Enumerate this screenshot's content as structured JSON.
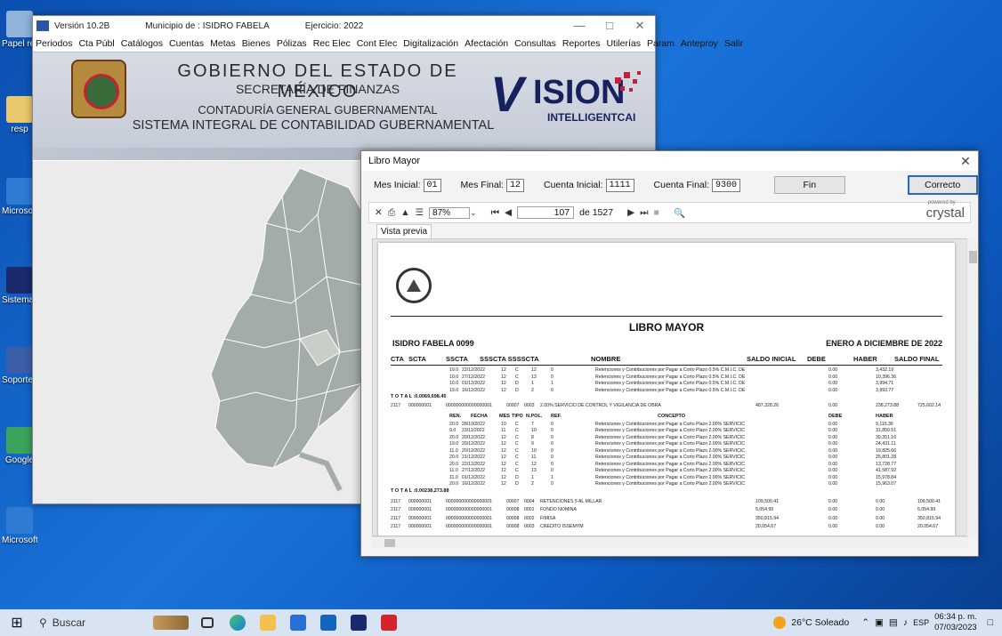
{
  "desktop": {
    "icons": [
      {
        "label": "Papel recicl",
        "icon": "recycle-bin-icon"
      },
      {
        "label": "resp",
        "icon": "folder-icon"
      },
      {
        "label": "Microsoft",
        "icon": "edge-icon"
      },
      {
        "label": "Sistema Conta",
        "icon": "vision-icon"
      },
      {
        "label": "Soporte C",
        "icon": "support-icon"
      },
      {
        "label": "Google",
        "icon": "chrome-icon"
      },
      {
        "label": "Microsoft Edge",
        "icon": "edge-icon"
      }
    ]
  },
  "main_window": {
    "version": "Versión 10.2B",
    "municipio": "Municipio de : ISIDRO FABELA",
    "ejercicio": "Ejercicio: 2022",
    "menu": [
      "Periodos",
      "Cta Públ",
      "Catálogos",
      "Cuentas",
      "Metas",
      "Bienes",
      "Pólizas",
      "Rec Elec",
      "Cont Elec",
      "Digitalización",
      "Afectación",
      "Consultas",
      "Reportes",
      "Utilerías",
      "Param",
      "Anteproy",
      "Salir"
    ],
    "banner": {
      "line1": "GOBIERNO DEL ESTADO DE MÉXICO",
      "line2": "SECRETARÍA DE FINANZAS",
      "line3": "CONTADURÍA GENERAL GUBERNAMENTAL",
      "line4": "SISTEMA INTEGRAL DE CONTABILIDAD GUBERNAMENTAL",
      "logo_v": "V",
      "logo_ision": "ISION",
      "logo_tag": "INTELLIGENTCAI"
    }
  },
  "libro_mayor": {
    "title": "Libro Mayor",
    "params": {
      "mes_inicial_label": "Mes Inicial:",
      "mes_inicial": "01",
      "mes_final_label": "Mes Final:",
      "mes_final": "12",
      "cuenta_inicial_label": "Cuenta Inicial:",
      "cuenta_inicial": "1111",
      "cuenta_final_label": "Cuenta Final:",
      "cuenta_final": "9300"
    },
    "fin_button": "Fin",
    "correcto_button": "Correcto",
    "toolbar": {
      "zoom": "87%",
      "page": "107",
      "page_of": "de 1527",
      "crystal_small": "powered by",
      "crystal": "crystal"
    },
    "tab": "Vista previa",
    "report": {
      "title": "LIBRO MAYOR",
      "municipio": "ISIDRO FABELA 0099",
      "periodo": "ENERO A DICIEMBRE DE 2022",
      "headers": [
        "CTA",
        "SCTA",
        "SSCTA",
        "SSSCTA SSSSCTA",
        "NOMBRE",
        "SALDO INICIAL",
        "DEBE",
        "HABER",
        "SALDO FINAL"
      ],
      "top_rows": [
        [
          "19.0",
          "22/12/2022",
          "12",
          "C",
          "12",
          "0",
          "Retenciones y Contribuciones por Pagar a Corto Plazo 0.5% C.M.I.C. DE",
          "0.00",
          "3,432.19"
        ],
        [
          "10.0",
          "27/12/2022",
          "12",
          "C",
          "13",
          "0",
          "Retenciones y Contribuciones por Pagar a Corto Plazo 0.5% C.M.I.C. DE",
          "0.00",
          "10,396.36"
        ],
        [
          "10.0",
          "01/12/2022",
          "12",
          "D",
          "1",
          "1",
          "Retenciones y Contribuciones por Pagar a Corto Plazo 0.5% C.M.I.C. DE",
          "0.00",
          "3,994.71"
        ],
        [
          "19.0",
          "16/12/2022",
          "12",
          "D",
          "2",
          "0",
          "Retenciones y Contribuciones por Pagar a Corto Plazo 0.5% C.M.I.C. DE",
          "0.00",
          "3,993.77"
        ]
      ],
      "total1_label": "T O T A L :",
      "total1_debe": "0.00",
      "total1_haber": "69,698.45",
      "account_row": [
        "2117",
        "000000001",
        "000000000000000001",
        "00007",
        "0003",
        "2.00% SERVICIO DE CONTROL Y VIGILANCIA DE OBRA",
        "487,328.26",
        "0.00",
        "238,273.88",
        "725,602.14"
      ],
      "sub_headers": [
        "REN.",
        "FECHA",
        "MES",
        "TIPO",
        "N.POL.",
        "REF.",
        "CONCEPTO",
        "DEBE",
        "HABER"
      ],
      "detail_rows": [
        [
          "20.0",
          "28/10/2022",
          "10",
          "C",
          "7",
          "0",
          "Retenciones y Contribuciones por Pagar a Corto Plazo 2.00% SERVICIC",
          "0.00",
          "9,115.36"
        ],
        [
          "9.0",
          "23/11/2022",
          "11",
          "C",
          "10",
          "0",
          "Retenciones y Contribuciones por Pagar a Corto Plazo 2.00% SERVICIC",
          "0.00",
          "31,850.51"
        ],
        [
          "20.0",
          "20/12/2022",
          "12",
          "C",
          "8",
          "0",
          "Retenciones y Contribuciones por Pagar a Corto Plazo 2.00% SERVICIC",
          "0.00",
          "39,351.16"
        ],
        [
          "19.0",
          "20/12/2022",
          "12",
          "C",
          "9",
          "0",
          "Retenciones y Contribuciones por Pagar a Corto Plazo 2.00% SERVICIC",
          "0.00",
          "24,431.11"
        ],
        [
          "11.0",
          "20/12/2022",
          "12",
          "C",
          "10",
          "0",
          "Retenciones y Contribuciones por Pagar a Corto Plazo 2.00% SERVICIC",
          "0.00",
          "19,825.66"
        ],
        [
          "20.0",
          "21/12/2022",
          "12",
          "C",
          "11",
          "0",
          "Retenciones y Contribuciones por Pagar a Corto Plazo 2.00% SERVICIC",
          "0.00",
          "25,801.28"
        ],
        [
          "20.0",
          "22/12/2022",
          "12",
          "C",
          "12",
          "0",
          "Retenciones y Contribuciones por Pagar a Corto Plazo 2.00% SERVICIC",
          "0.00",
          "13,728.77"
        ],
        [
          "11.0",
          "27/12/2022",
          "12",
          "C",
          "13",
          "0",
          "Retenciones y Contribuciones por Pagar a Corto Plazo 2.00% SERVICIC",
          "0.00",
          "41,587.92"
        ],
        [
          "11.0",
          "01/12/2022",
          "12",
          "D",
          "1",
          "1",
          "Retenciones y Contribuciones por Pagar a Corto Plazo 2.00% SERVICIC",
          "0.00",
          "15,978.84"
        ],
        [
          "20.0",
          "16/12/2022",
          "12",
          "D",
          "2",
          "0",
          "Retenciones y Contribuciones por Pagar a Corto Plazo 2.00% SERVICIC",
          "0.00",
          "15,963.07"
        ]
      ],
      "total2_label": "T O T A L :",
      "total2_debe": "0.00",
      "total2_haber": "238,273.88",
      "bottom_rows": [
        [
          "2117",
          "000000001",
          "000000000000000001",
          "00007",
          "0004",
          "RETENCIONES 5 AL MILLAR",
          "109,500.41",
          "0.00",
          "0.00",
          "109,500.41"
        ],
        [
          "2117",
          "000000001",
          "000000000000000001",
          "00008",
          "0001",
          "FONDO NOMINA",
          "5,054.99",
          "0.00",
          "0.00",
          "5,054.99"
        ],
        [
          "2117",
          "000000001",
          "000000000000000001",
          "00008",
          "0002",
          "FIMISA",
          "350,815.94",
          "0.00",
          "0.00",
          "350,815.94"
        ],
        [
          "2117",
          "000000001",
          "000000000000000001",
          "00008",
          "0003",
          "CREDITO ISSEMYM",
          "20,054.67",
          "0.00",
          "0.00",
          "20,054.67"
        ]
      ]
    }
  },
  "taskbar": {
    "search_placeholder": "Buscar",
    "weather": "26°C Soleado",
    "lang": "ESP",
    "time": "06:34 p. m.",
    "date": "07/03/2023"
  }
}
